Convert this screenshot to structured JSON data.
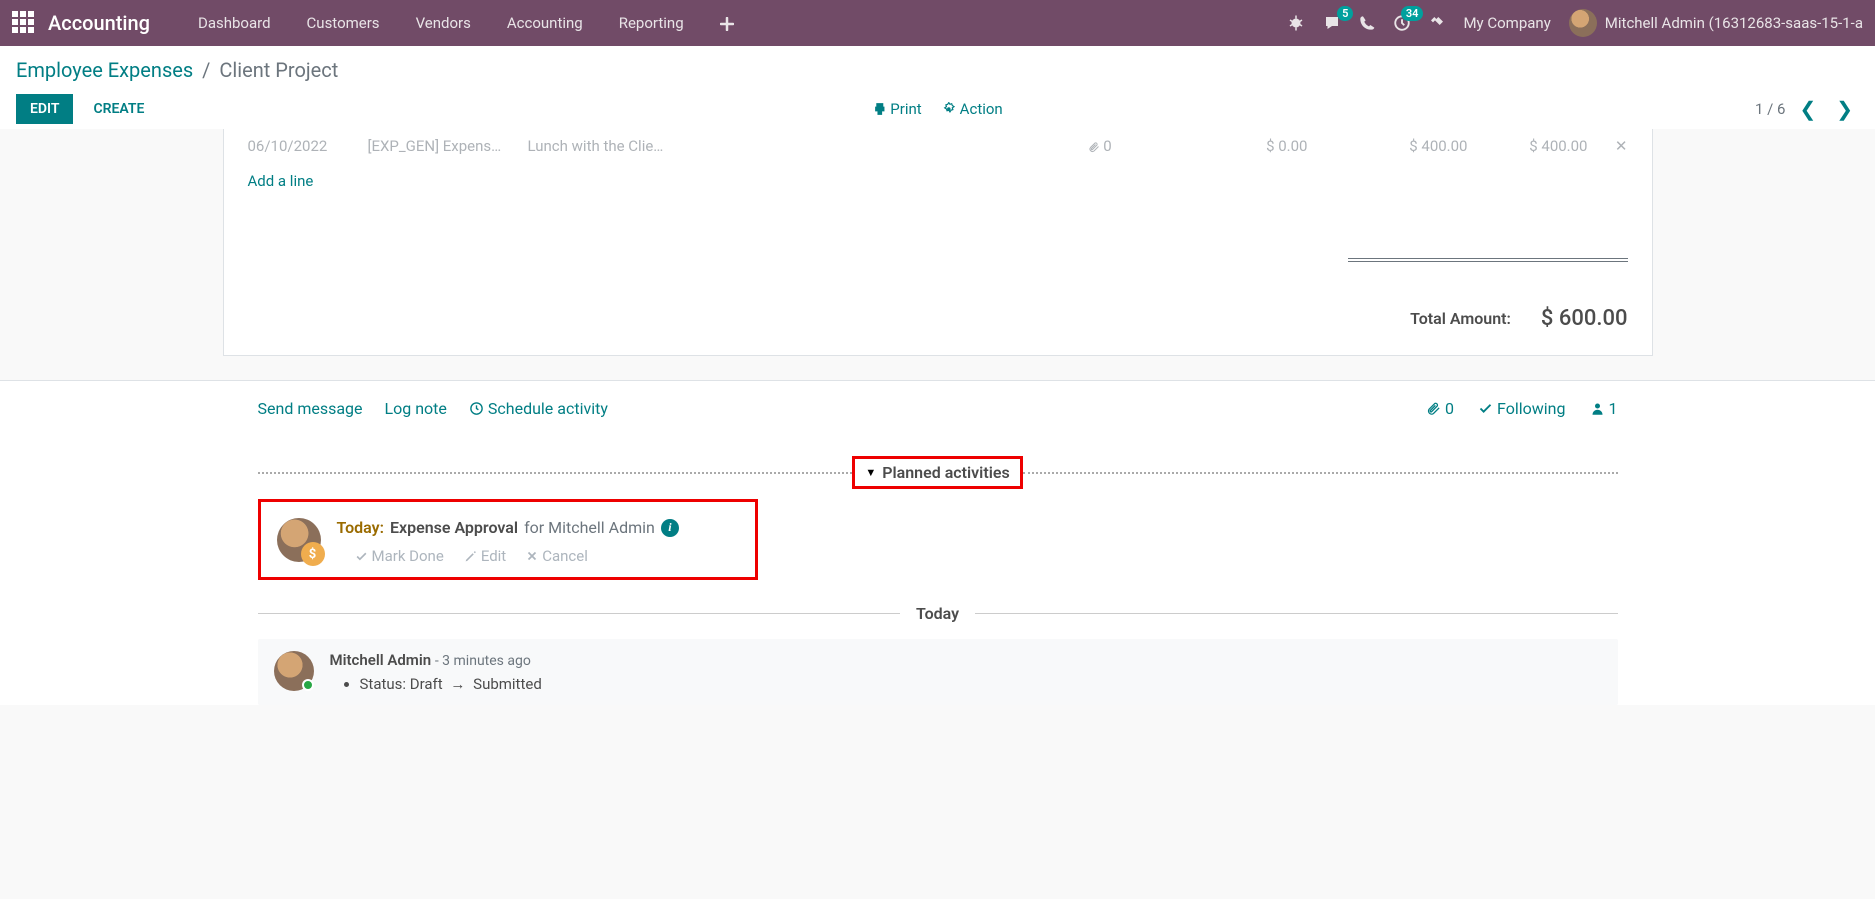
{
  "navbar": {
    "brand": "Accounting",
    "menu": [
      "Dashboard",
      "Customers",
      "Vendors",
      "Accounting",
      "Reporting"
    ],
    "messaging_badge": "5",
    "activities_badge": "34",
    "company": "My Company",
    "user": "Mitchell Admin (16312683-saas-15-1-a"
  },
  "breadcrumb": {
    "parent": "Employee Expenses",
    "current": "Client Project"
  },
  "buttons": {
    "edit": "EDIT",
    "create": "CREATE",
    "print": "Print",
    "action": "Action"
  },
  "pager": {
    "text": "1 / 6"
  },
  "expense_lines": [
    {
      "date": "06/10/2022",
      "product": "[EXP_GEN] Expens…",
      "description": "Lunch with the Clie…",
      "attachments": "0",
      "unit": "$ 0.00",
      "subtotal": "$ 400.00",
      "total": "$ 400.00"
    }
  ],
  "add_line": "Add a line",
  "total": {
    "label": "Total Amount:",
    "value": "$ 600.00"
  },
  "chatter": {
    "send_message": "Send message",
    "log_note": "Log note",
    "schedule_activity": "Schedule activity",
    "attachments": "0",
    "following": "Following",
    "followers": "1"
  },
  "planned_activities": {
    "label": "Planned activities",
    "activity": {
      "due": "Today:",
      "title": "Expense Approval",
      "for": "for Mitchell Admin",
      "mark_done": "Mark Done",
      "edit": "Edit",
      "cancel": "Cancel"
    }
  },
  "messages": {
    "today_label": "Today",
    "log": {
      "author": "Mitchell Admin",
      "time": "- 3 minutes ago",
      "status_label": "Status:",
      "old": "Draft",
      "new": "Submitted"
    }
  }
}
